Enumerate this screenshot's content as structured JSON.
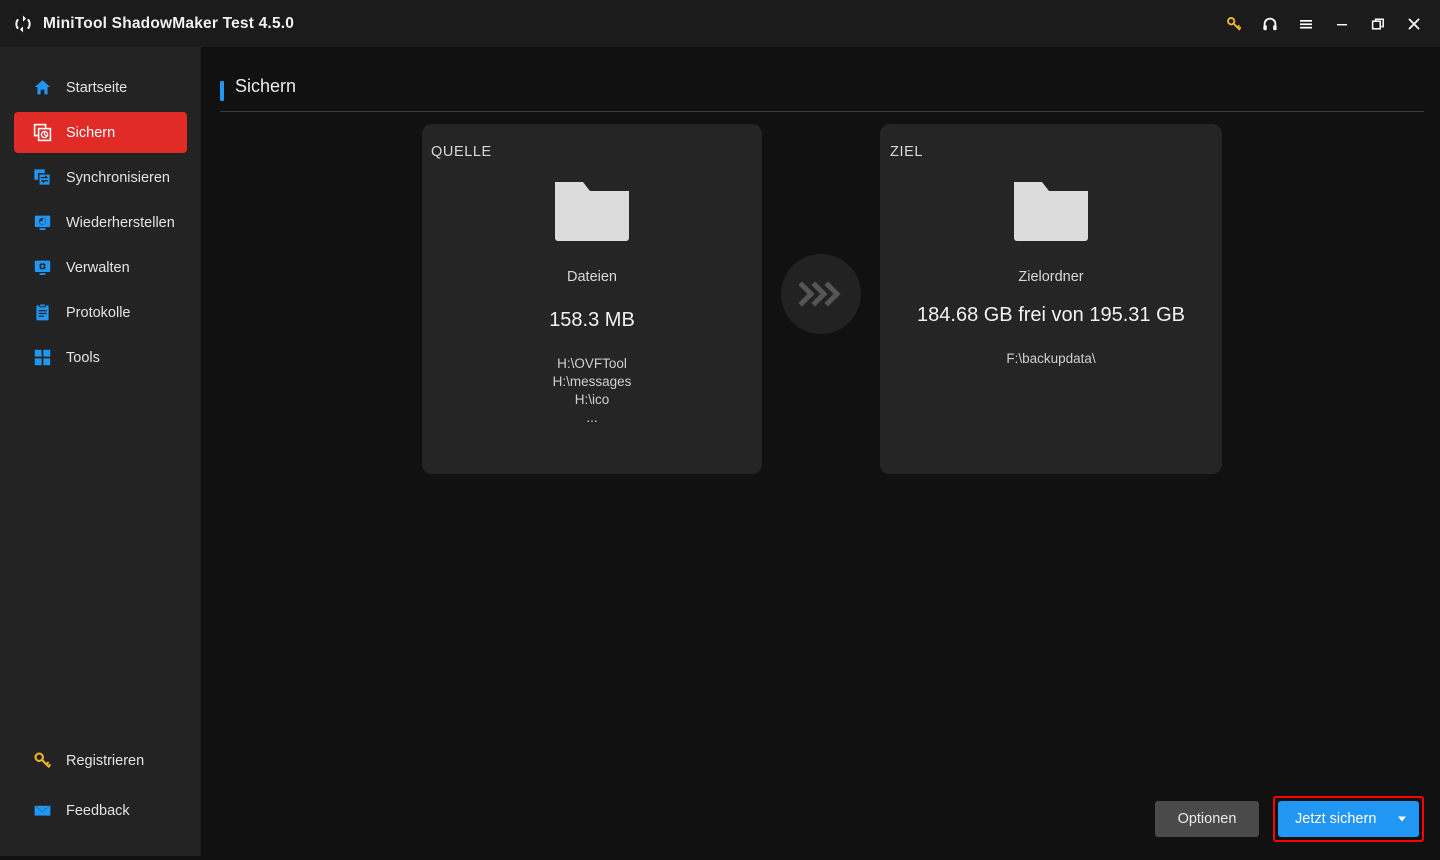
{
  "titlebar": {
    "app_title": "MiniTool ShadowMaker Test 4.5.0",
    "logo_icon": "refresh-arrows-icon",
    "controls": [
      {
        "name": "key-icon",
        "label": "Register",
        "color": "#f0b429"
      },
      {
        "name": "headset-icon",
        "label": "Support",
        "color": "#ffffff"
      },
      {
        "name": "hamburger-icon",
        "label": "Menu",
        "color": "#ffffff"
      },
      {
        "name": "minimize-icon",
        "label": "Minimize",
        "color": "#ffffff"
      },
      {
        "name": "restore-icon",
        "label": "Restore",
        "color": "#ffffff"
      },
      {
        "name": "close-icon",
        "label": "Close",
        "color": "#ffffff"
      }
    ]
  },
  "sidebar": {
    "items": [
      {
        "label": "Startseite",
        "icon": "home-icon",
        "active": false
      },
      {
        "label": "Sichern",
        "icon": "backup-icon",
        "active": true
      },
      {
        "label": "Synchronisieren",
        "icon": "sync-icon",
        "active": false
      },
      {
        "label": "Wiederherstellen",
        "icon": "restore-monitor-icon",
        "active": false
      },
      {
        "label": "Verwalten",
        "icon": "manage-gear-icon",
        "active": false
      },
      {
        "label": "Protokolle",
        "icon": "clipboard-icon",
        "active": false
      },
      {
        "label": "Tools",
        "icon": "grid-squares-icon",
        "active": false
      }
    ],
    "bottom_items": [
      {
        "label": "Registrieren",
        "icon": "key-icon",
        "color": "#f0b429"
      },
      {
        "label": "Feedback",
        "icon": "envelope-icon",
        "color": "#2196f3"
      }
    ],
    "active_color": "#e02b26"
  },
  "main": {
    "page_title": "Sichern",
    "accent_color": "#2196f3",
    "source_card": {
      "kicker": "QUELLE",
      "icon": "folder-icon",
      "type_label": "Dateien",
      "size": "158.3 MB",
      "paths": "H:\\OVFTool\nH:\\messages\nH:\\ico\n..."
    },
    "connector_icon": "triple-chevron-right-icon",
    "dest_card": {
      "kicker": "ZIEL",
      "icon": "folder-icon",
      "type_label": "Zielordner",
      "capacity": "184.68 GB frei von 195.31 GB",
      "path": "F:\\backupdata\\"
    },
    "footer": {
      "options_label": "Optionen",
      "backup_label": "Jetzt sichern",
      "backup_color": "#2196f3",
      "highlight_color": "#ff0000"
    }
  }
}
